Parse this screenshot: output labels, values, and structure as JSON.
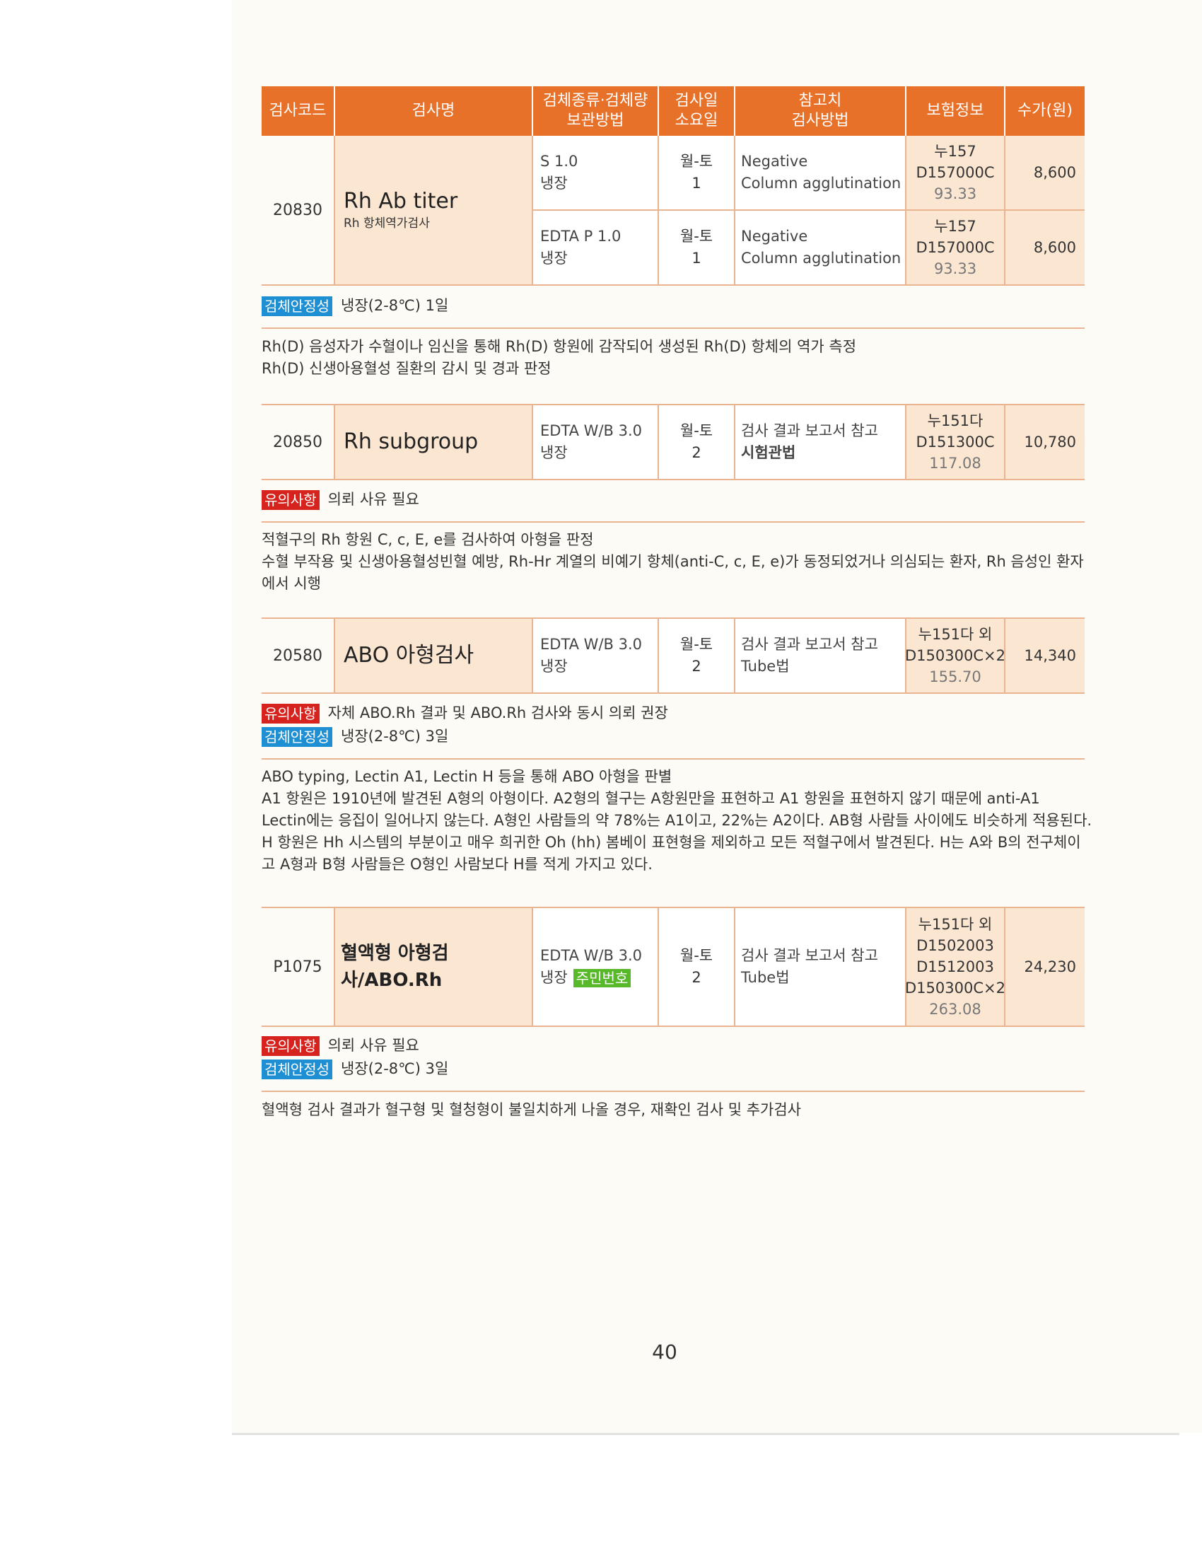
{
  "header": {
    "code": "검사코드",
    "name": "검사명",
    "specimen_1": "검체종류·검체량",
    "specimen_2": "보관방법",
    "days_1": "검사일",
    "days_2": "소요일",
    "ref_1": "참고치",
    "ref_2": "검사방법",
    "insurance": "보험정보",
    "fee": "수가(원)"
  },
  "tests": [
    {
      "code": "20830",
      "name": "Rh Ab titer",
      "name_sub": "Rh 항체역가검사",
      "rows": [
        {
          "specimen": "S 1.0",
          "storage": "냉장",
          "days": "월-토",
          "tat": "1",
          "ref": "Negative",
          "method": "Column agglutination",
          "ins_1": "누157",
          "ins_2": "D157000C",
          "ins_3": "93.33",
          "fee": "8,600"
        },
        {
          "specimen": "EDTA P 1.0",
          "storage": "냉장",
          "days": "월-토",
          "tat": "1",
          "ref": "Negative",
          "method": "Column agglutination",
          "ins_1": "누157",
          "ins_2": "D157000C",
          "ins_3": "93.33",
          "fee": "8,600"
        }
      ],
      "notes": [
        {
          "badge": "검체안정성",
          "text": "냉장(2-8℃) 1일"
        }
      ],
      "desc": [
        "Rh(D) 음성자가 수혈이나 임신을 통해 Rh(D) 항원에 감작되어 생성된 Rh(D) 항체의 역가 측정",
        "Rh(D) 신생아용혈성 질환의 감시 및 경과 판정"
      ]
    },
    {
      "code": "20850",
      "name": "Rh subgroup",
      "specimen": "EDTA W/B 3.0",
      "storage": "냉장",
      "days": "월-토",
      "tat": "2",
      "ref": "검사 결과 보고서 참고",
      "method": "시험관법",
      "ins_1": "누151다",
      "ins_2": "D151300C",
      "ins_3": "117.08",
      "fee": "10,780",
      "notes": [
        {
          "badge": "유의사항",
          "text": "의뢰 사유 필요"
        }
      ],
      "desc": [
        "적혈구의 Rh 항원 C, c, E, e를 검사하여 아형을 판정",
        "수혈 부작용 및 신생아용혈성빈혈 예방, Rh-Hr 계열의 비예기 항체(anti-C, c, E, e)가 동정되었거나 의심되는 환자, Rh 음성인 환자",
        "에서 시행"
      ]
    },
    {
      "code": "20580",
      "name": "ABO 아형검사",
      "specimen": "EDTA W/B 3.0",
      "storage": "냉장",
      "days": "월-토",
      "tat": "2",
      "ref": "검사 결과 보고서 참고",
      "method": "Tube법",
      "ins_1": "누151다 외",
      "ins_2": "D150300C×2",
      "ins_3": "155.70",
      "fee": "14,340",
      "notes": [
        {
          "badge": "유의사항",
          "text": "자체 ABO.Rh 결과 및 ABO.Rh 검사와 동시 의뢰 권장"
        },
        {
          "badge": "검체안정성",
          "text": "냉장(2-8℃) 3일"
        }
      ],
      "desc": [
        "ABO typing, Lectin A1, Lectin H 등을 통해 ABO 아형을 판별",
        "A1 항원은 1910년에 발견된 A형의 아형이다. A2형의 혈구는 A항원만을 표현하고 A1 항원을 표현하지 않기 때문에 anti-A1",
        "Lectin에는 응집이 일어나지 않는다. A형인 사람들의 약 78%는 A1이고, 22%는 A2이다. AB형 사람들 사이에도 비슷하게 적용된다.",
        "H 항원은 Hh 시스템의 부분이고 매우 희귀한 Oh (hh) 봄베이 표현형을 제외하고 모든 적혈구에서 발견된다. H는 A와 B의 전구체이",
        "고 A형과 B형 사람들은 O형인 사람보다 H를 적게 가지고 있다."
      ]
    },
    {
      "code": "P1075",
      "name": "혈액형 아형검사/ABO.Rh",
      "specimen": "EDTA W/B 3.0",
      "storage": "냉장",
      "storage_badge": "주민번호",
      "days": "월-토",
      "tat": "2",
      "ref": "검사 결과 보고서 참고",
      "method": "Tube법",
      "ins_1": "누151다 외",
      "ins_2": "D1502003",
      "ins_3": "D1512003",
      "ins_4": "D150300C×2",
      "ins_5": "263.08",
      "fee": "24,230",
      "notes": [
        {
          "badge": "유의사항",
          "text": "의뢰 사유 필요"
        },
        {
          "badge": "검체안정성",
          "text": "냉장(2-8℃) 3일"
        }
      ],
      "desc": [
        "혈액형 검사 결과가 혈구형 및 혈청형이 불일치하게 나올 경우, 재확인 검사 및 추가검사"
      ]
    }
  ],
  "page_number": "40"
}
